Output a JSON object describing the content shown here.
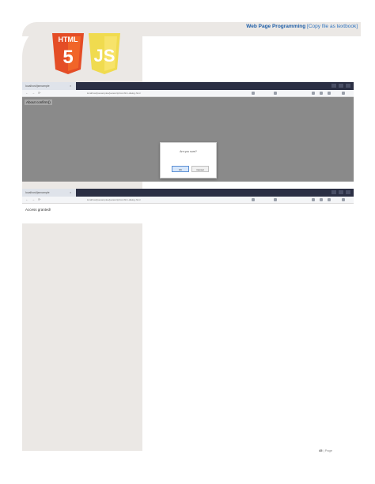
{
  "header": {
    "title": "Web Page Programming",
    "subtitle": "[Copy file as textbook]"
  },
  "logo": {
    "html_text": "HTML",
    "html_number": "5",
    "js_text": "JS"
  },
  "screenshot1": {
    "tab_label": "localhost/jsexample",
    "tab_close": "×",
    "nav_back": "←",
    "nav_forward": "→",
    "nav_reload": "⟳",
    "url": "localhost/jsexamples/javascript/confirm-dialog.html",
    "overlay_text": "About confirm()",
    "dialog": {
      "message": "Are you sure?",
      "ok_label": "OK",
      "cancel_label": "Cancel"
    }
  },
  "screenshot2": {
    "tab_label": "localhost/jsexample",
    "tab_close": "×",
    "nav_back": "←",
    "nav_forward": "→",
    "nav_reload": "⟳",
    "url": "localhost/jsexamples/javascript/confirm-dialog.html",
    "body_text": "Access granted!"
  },
  "footer": {
    "page_number": "45",
    "page_label": "| Page"
  },
  "colors": {
    "sidebar": "#ebe8e5",
    "tab_strip": "#2b2f44",
    "title_blue": "#1f5fa8",
    "html5_orange": "#e44d26",
    "js_yellow": "#f0db4f"
  }
}
